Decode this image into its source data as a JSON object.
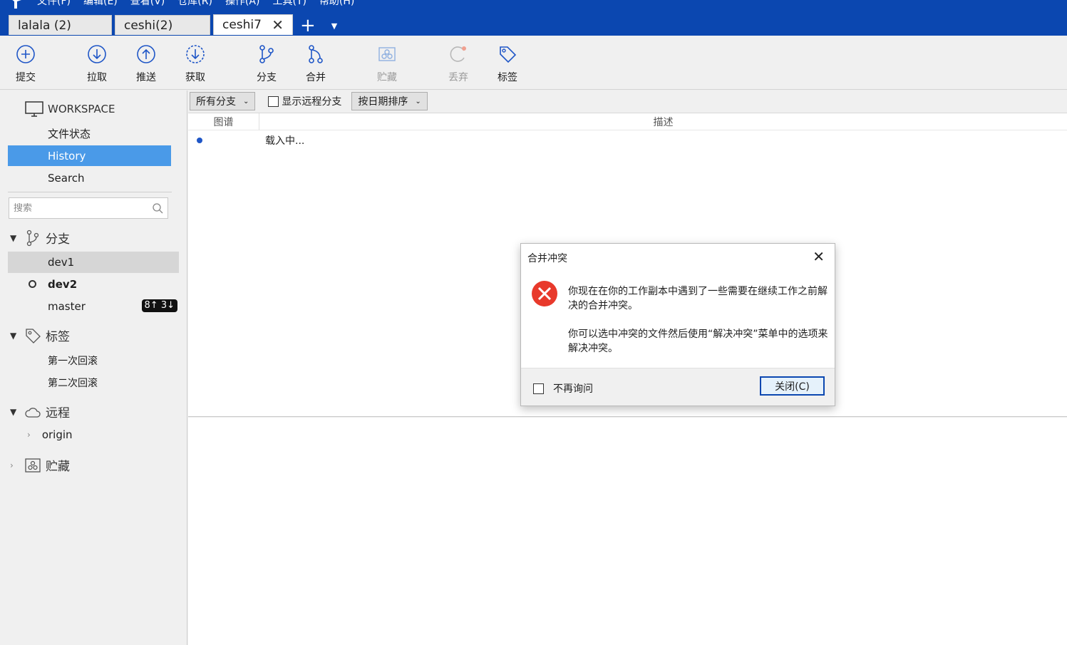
{
  "menu": [
    "文件(F)",
    "编辑(E)",
    "查看(V)",
    "仓库(R)",
    "操作(A)",
    "工具(T)",
    "帮助(H)"
  ],
  "tabs": [
    {
      "label": "lalala (2)"
    },
    {
      "label": "ceshi(2)"
    },
    {
      "label": "ceshi7"
    }
  ],
  "toolbar": {
    "commit": "提交",
    "pull": "拉取",
    "push": "推送",
    "fetch": "获取",
    "branch": "分支",
    "merge": "合并",
    "stash": "贮藏",
    "discard": "丢弃",
    "tag": "标签"
  },
  "sidebar": {
    "workspace": "WORKSPACE",
    "items": [
      "文件状态",
      "History",
      "Search"
    ],
    "search_placeholder": "搜索",
    "branches_header": "分支",
    "branches": [
      {
        "name": "dev1"
      },
      {
        "name": "dev2"
      },
      {
        "name": "master",
        "badge": "8↑ 3↓"
      }
    ],
    "tags_header": "标签",
    "tags": [
      "第一次回滚",
      "第二次回滚"
    ],
    "remotes_header": "远程",
    "remotes": [
      "origin"
    ],
    "stash_header": "贮藏"
  },
  "main": {
    "branch_filter": "所有分支",
    "show_remote": "显示远程分支",
    "sort": "按日期排序",
    "col_graph": "图谱",
    "col_desc": "描述",
    "loading": "载入中..."
  },
  "dialog": {
    "title": "合并冲突",
    "message1": "你现在在你的工作副本中遇到了一些需要在继续工作之前解决的合并冲突。",
    "message2": "你可以选中冲突的文件然后使用“解决冲突”菜单中的选项来解决冲突。",
    "dont_ask": "不再询问",
    "close_button": "关闭(C)"
  },
  "colors": {
    "titlebar": "#0b47b0",
    "selection": "#4a9ae8",
    "accent": "#1f56c7",
    "error": "#e8392b"
  }
}
